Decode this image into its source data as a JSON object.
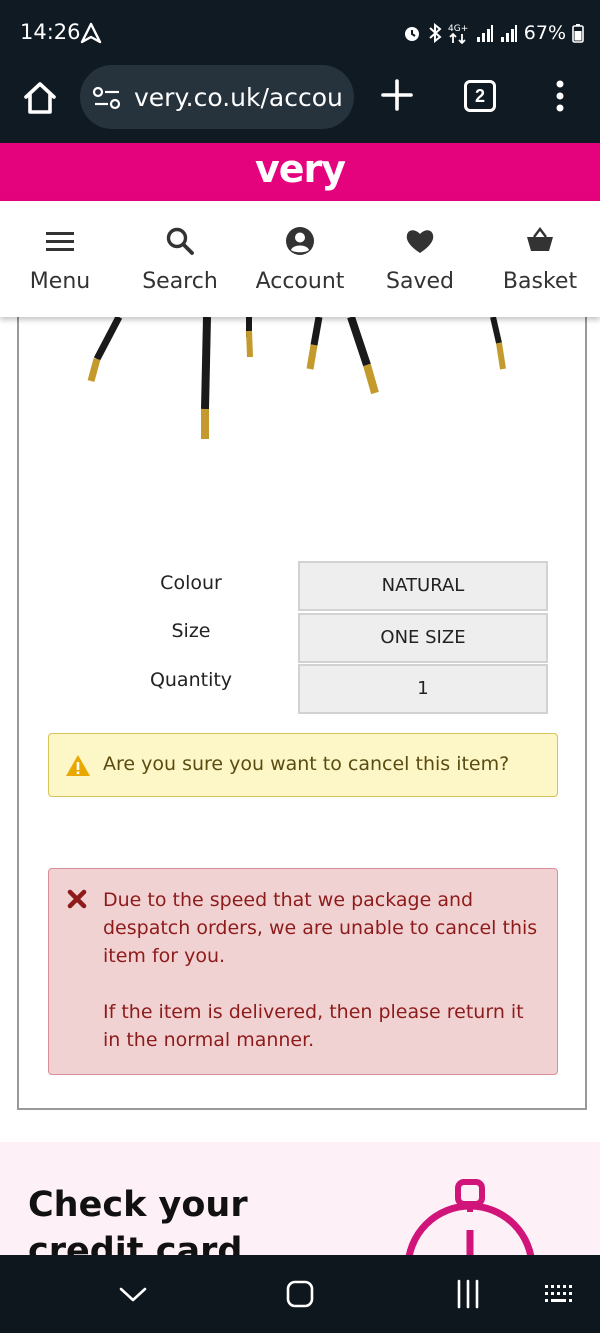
{
  "status_bar": {
    "time": "14:26",
    "battery": "67%"
  },
  "browser": {
    "url": "very.co.uk/account",
    "tab_count": "2"
  },
  "brand": {
    "logo": "very",
    "color": "#e5037d"
  },
  "site_nav": {
    "items": [
      {
        "label": "Menu",
        "icon": "hamburger-icon"
      },
      {
        "label": "Search",
        "icon": "search-icon"
      },
      {
        "label": "Account",
        "icon": "account-icon"
      },
      {
        "label": "Saved",
        "icon": "heart-icon"
      },
      {
        "label": "Basket",
        "icon": "basket-icon"
      }
    ]
  },
  "order_item": {
    "options": [
      {
        "label": "Colour",
        "value": "NATURAL"
      },
      {
        "label": "Size",
        "value": "ONE SIZE"
      },
      {
        "label": "Quantity",
        "value": "1"
      }
    ]
  },
  "confirm_alert": {
    "text": "Are you sure you want to cancel this item?"
  },
  "error_alert": {
    "line1": "Due to the speed that we package and despatch orders, we are unable to cancel this item for you.",
    "line2": "If the item is delivered, then please return it in the normal manner."
  },
  "promo": {
    "heading": "Check your credit card"
  },
  "colors": {
    "status_bg": "#101a22",
    "warning_bg": "#fdf6c6",
    "error_bg": "#f1d2d2",
    "error_text": "#8e1b1b"
  }
}
